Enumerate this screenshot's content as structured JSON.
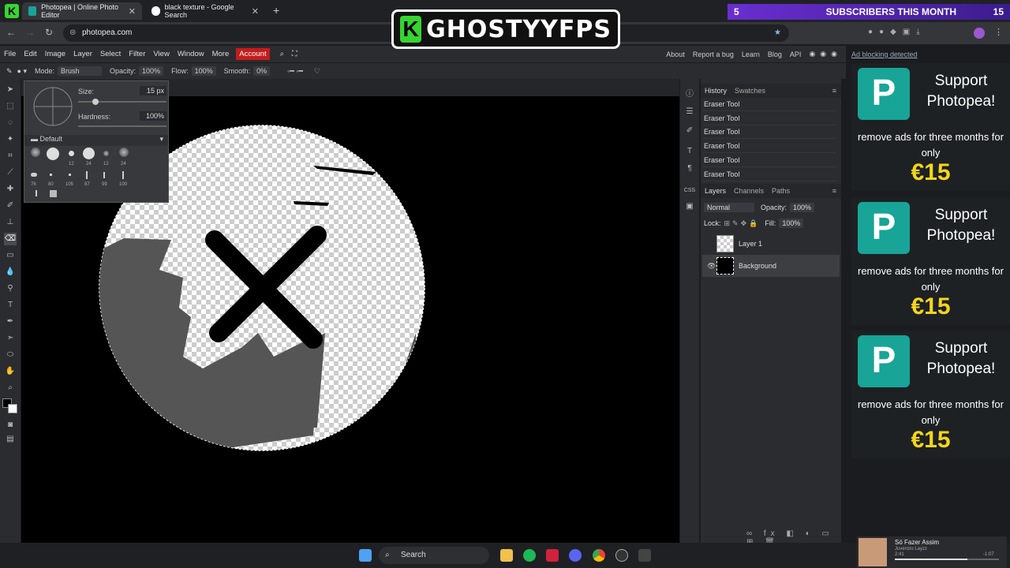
{
  "browser": {
    "tabs": [
      {
        "title": "Photopea | Online Photo Editor",
        "active": true
      },
      {
        "title": "black texture - Google Search",
        "active": false
      }
    ],
    "new_tab": "+",
    "url": "photopea.com"
  },
  "overlay": {
    "channel_name": "GHOSTYYFPS",
    "subs_count": "5",
    "subs_text": "SUBSCRIBERS THIS MONTH",
    "subs_goal": "15"
  },
  "menu": {
    "items": [
      "File",
      "Edit",
      "Image",
      "Layer",
      "Select",
      "Filter",
      "View",
      "Window",
      "More"
    ],
    "account": "Account",
    "right": [
      "About",
      "Report a bug",
      "Learn",
      "Blog",
      "API"
    ]
  },
  "options": {
    "mode_label": "Mode:",
    "mode_value": "Brush",
    "opacity_label": "Opacity:",
    "opacity_value": "100%",
    "flow_label": "Flow:",
    "flow_value": "100%",
    "smooth_label": "Smooth:",
    "smooth_value": "0%"
  },
  "brush_popup": {
    "size_label": "Size:",
    "size_value": "15  px",
    "size_fraction": 0.2,
    "hardness_label": "Hardness:",
    "hardness_value": "100%",
    "preset_group": "Default",
    "preset_sizes_row1": [
      "",
      "",
      "12",
      "24",
      "12",
      "24"
    ],
    "preset_sizes_row2": [
      "76",
      "80",
      "105",
      "87",
      "99",
      "100"
    ]
  },
  "history": {
    "tabs": [
      "History",
      "Swatches"
    ],
    "items": [
      "Eraser Tool",
      "Eraser Tool",
      "Eraser Tool",
      "Eraser Tool",
      "Eraser Tool",
      "Eraser Tool"
    ]
  },
  "layers": {
    "tabs": [
      "Layers",
      "Channels",
      "Paths"
    ],
    "blend": "Normal",
    "opacity_label": "Opacity:",
    "opacity_value": "100%",
    "lock_label": "Lock:",
    "fill_label": "Fill:",
    "fill_value": "100%",
    "items": [
      {
        "name": "Layer 1",
        "visible": false
      },
      {
        "name": "Background",
        "visible": true
      }
    ]
  },
  "ads": {
    "label": "Ad blocking detected",
    "cards": [
      {
        "title": "Support Photopea!",
        "text": "remove ads for three months for only",
        "price": "€15"
      },
      {
        "title": "Support Photopea!",
        "text": "remove ads for three months for only",
        "price": "€15"
      },
      {
        "title": "Support Photopea!",
        "text": "remove ads for three months for only",
        "price": "€15"
      }
    ]
  },
  "taskbar": {
    "search": "Search",
    "media_title": "Só Fazer Assim",
    "media_artist": "Juvenzio Layzz",
    "media_elapsed": "2:41",
    "media_remaining": "-1:07"
  },
  "colors": {
    "accent_account": "#c41c1c",
    "ad_price": "#f6d51b",
    "photopea_teal": "#18a497",
    "subs_bar": "#6a2ed1"
  }
}
